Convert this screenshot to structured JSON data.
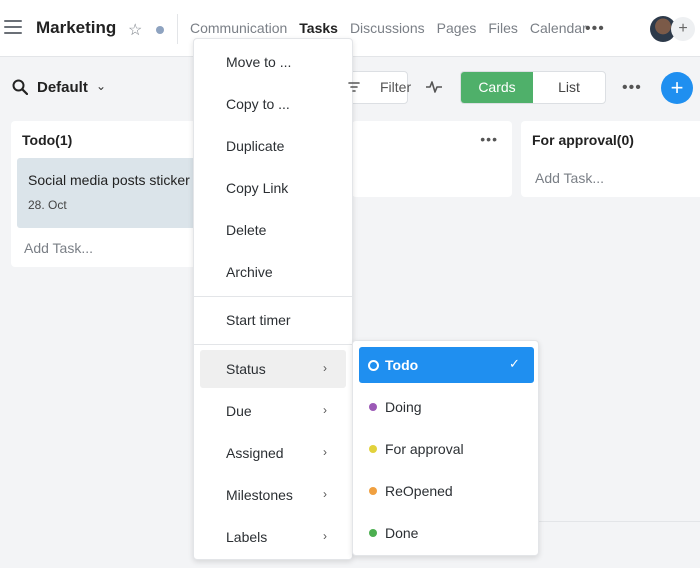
{
  "header": {
    "title": "Marketing",
    "star_icon": "star-icon",
    "nav_tabs": [
      {
        "label": "Communication",
        "active": false
      },
      {
        "label": "Tasks",
        "active": true
      },
      {
        "label": "Discussions",
        "active": false
      },
      {
        "label": "Pages",
        "active": false
      },
      {
        "label": "Files",
        "active": false
      },
      {
        "label": "Calendar",
        "active": false
      }
    ],
    "more_label": "•••",
    "add_label": "+"
  },
  "toolbar": {
    "view_name": "Default",
    "filter_label": "Filter",
    "view_modes": [
      {
        "label": "Cards",
        "active": true
      },
      {
        "label": "List",
        "active": false
      }
    ],
    "more_label": "•••",
    "add_label": "+",
    "accent_color": "#4fb06a",
    "fab_color": "#1f8ff0"
  },
  "board": {
    "columns": [
      {
        "title": "Todo(1)",
        "cards": [
          {
            "title": "Social media posts sticker",
            "date": "28. Oct"
          }
        ],
        "add_task": "Add Task..."
      },
      {
        "title": "",
        "more": "•••",
        "add_task": ""
      },
      {
        "title": "For approval(0)",
        "add_task": "Add Task..."
      }
    ]
  },
  "context_menu": {
    "items": [
      {
        "label": "Move to ..."
      },
      {
        "label": "Copy to ..."
      },
      {
        "label": "Duplicate"
      },
      {
        "label": "Copy Link"
      },
      {
        "label": "Delete"
      },
      {
        "label": "Archive"
      },
      {
        "label": "Start timer"
      },
      {
        "label": "Status"
      },
      {
        "label": "Due"
      },
      {
        "label": "Assigned"
      },
      {
        "label": "Milestones"
      },
      {
        "label": "Labels"
      }
    ]
  },
  "status_menu": {
    "items": [
      {
        "label": "Todo",
        "color": "#ffffff",
        "selected": true
      },
      {
        "label": "Doing",
        "color": "#9b59b6",
        "selected": false
      },
      {
        "label": "For approval",
        "color": "#e2d23c",
        "selected": false
      },
      {
        "label": "ReOpened",
        "color": "#f0a040",
        "selected": false
      },
      {
        "label": "Done",
        "color": "#4caf50",
        "selected": false
      }
    ],
    "check_mark": "✓",
    "selected_color": "#1f8ff0"
  }
}
